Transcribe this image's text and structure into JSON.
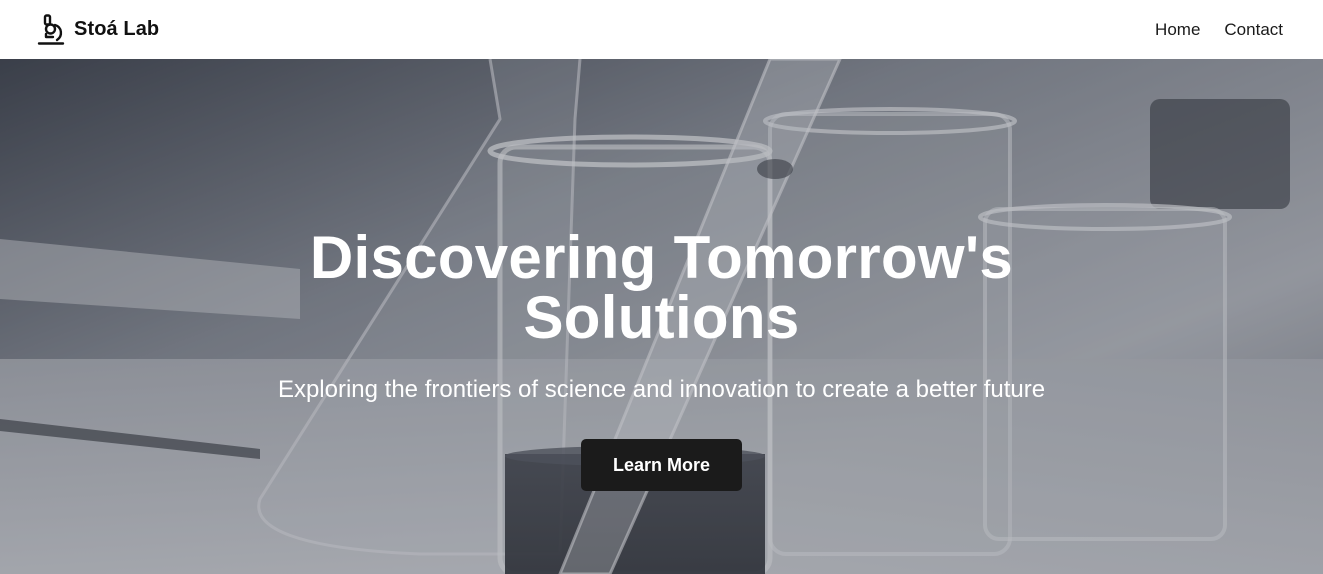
{
  "brand": {
    "name": "Stoá Lab",
    "icon": "microscope-icon"
  },
  "nav": {
    "links": [
      {
        "label": "Home"
      },
      {
        "label": "Contact"
      }
    ]
  },
  "hero": {
    "title": "Discovering Tomorrow's Solutions",
    "subtitle": "Exploring the frontiers of science and innovation to create a better future",
    "button_label": "Learn More",
    "background": "laboratory-glassware-photo"
  },
  "colors": {
    "nav_background": "#ffffff",
    "button_background": "#1b1b1b",
    "hero_text": "#ffffff"
  }
}
